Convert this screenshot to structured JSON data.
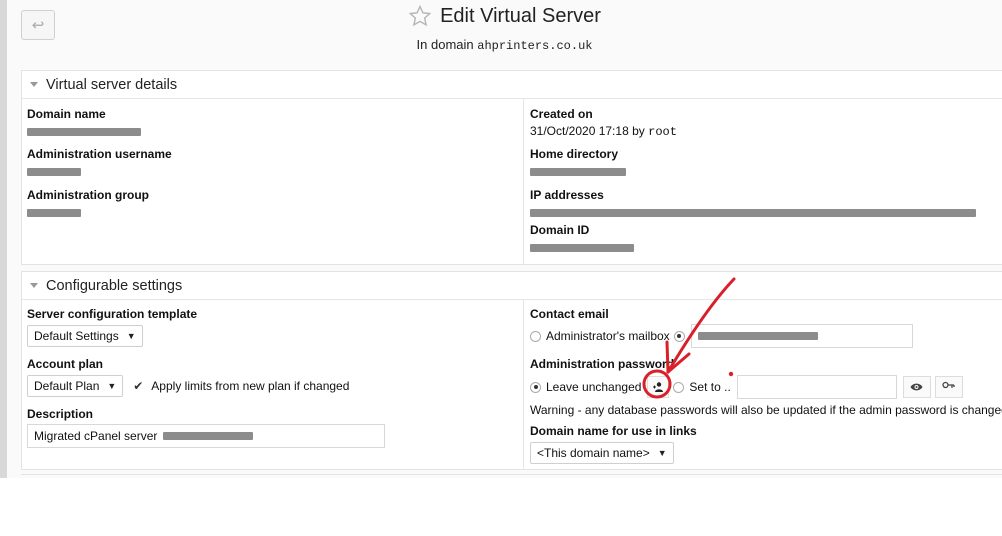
{
  "header": {
    "back_label": "↩",
    "title": "Edit Virtual Server",
    "subtitle_prefix": "In domain",
    "domain": "ahprinters.co.uk"
  },
  "details": {
    "heading": "Virtual server details",
    "domain_name_label": "Domain name",
    "admin_username_label": "Administration username",
    "admin_group_label": "Administration group",
    "created_on_label": "Created on",
    "created_on_value": "31/Oct/2020 17:18",
    "created_by_prefix": "by",
    "created_by_user": "root",
    "home_dir_label": "Home directory",
    "ip_addresses_label": "IP addresses",
    "domain_id_label": "Domain ID"
  },
  "settings": {
    "heading": "Configurable settings",
    "template_label": "Server configuration template",
    "template_value": "Default Settings",
    "account_plan_label": "Account plan",
    "account_plan_value": "Default Plan",
    "apply_limits_label": "Apply limits from new plan if changed",
    "description_label": "Description",
    "description_value": "Migrated cPanel server",
    "contact_email_label": "Contact email",
    "contact_email_option_mailbox": "Administrator's mailbox",
    "admin_password_label": "Administration password",
    "pw_option_unchanged": "Leave unchanged",
    "pw_option_set": "Set to ..",
    "pw_warning": "Warning - any database passwords will also be updated if the admin password is changed",
    "links_domain_label": "Domain name for use in links",
    "links_domain_value": "<This domain name>"
  },
  "colors": {
    "annotation_red": "#d9202a",
    "redaction_gray": "#8c8c8c"
  }
}
